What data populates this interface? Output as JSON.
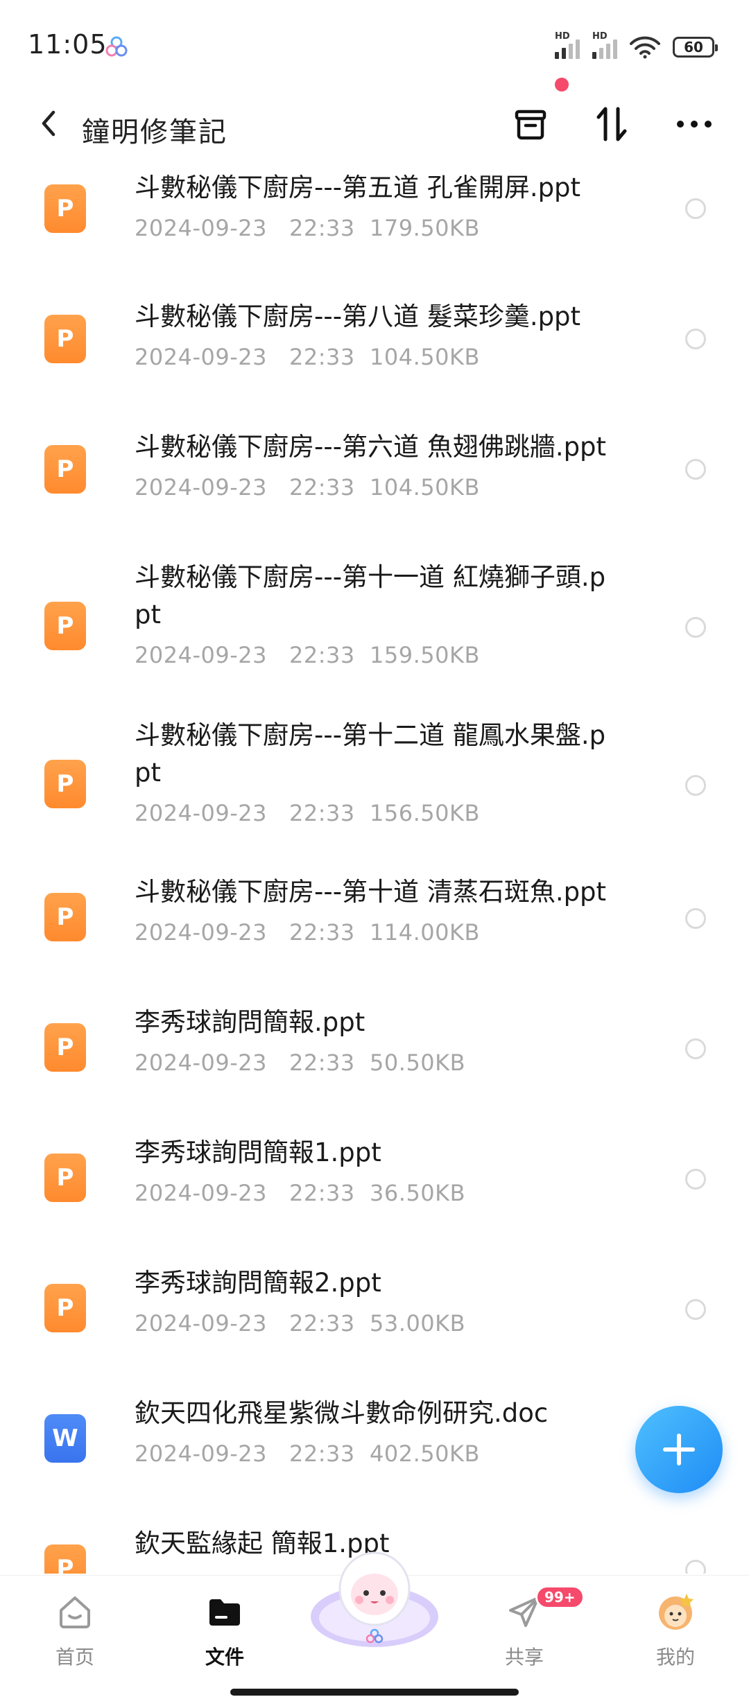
{
  "status_bar": {
    "time": "11:05",
    "signal_1_label": "HD",
    "signal_2_label": "HD",
    "battery": "60"
  },
  "header": {
    "title": "鐘明修筆記"
  },
  "files": [
    {
      "name": "斗數秘儀下廚房---第五道 孔雀開屏.ppt",
      "date": "2024-09-23",
      "time": "22:33",
      "size": "179.50KB",
      "type": "ppt",
      "icon_letter": "P"
    },
    {
      "name": "斗數秘儀下廚房---第八道 髮菜珍羹.ppt",
      "date": "2024-09-23",
      "time": "22:33",
      "size": "104.50KB",
      "type": "ppt",
      "icon_letter": "P"
    },
    {
      "name": "斗數秘儀下廚房---第六道 魚翅佛跳牆.ppt",
      "date": "2024-09-23",
      "time": "22:33",
      "size": "104.50KB",
      "type": "ppt",
      "icon_letter": "P"
    },
    {
      "name": "斗數秘儀下廚房---第十一道 紅燒獅子頭.ppt",
      "date": "2024-09-23",
      "time": "22:33",
      "size": "159.50KB",
      "type": "ppt",
      "icon_letter": "P"
    },
    {
      "name": "斗數秘儀下廚房---第十二道 龍鳳水果盤.ppt",
      "date": "2024-09-23",
      "time": "22:33",
      "size": "156.50KB",
      "type": "ppt",
      "icon_letter": "P"
    },
    {
      "name": "斗數秘儀下廚房---第十道 清蒸石斑魚.ppt",
      "date": "2024-09-23",
      "time": "22:33",
      "size": "114.00KB",
      "type": "ppt",
      "icon_letter": "P"
    },
    {
      "name": "李秀球詢問簡報.ppt",
      "date": "2024-09-23",
      "time": "22:33",
      "size": "50.50KB",
      "type": "ppt",
      "icon_letter": "P"
    },
    {
      "name": "李秀球詢問簡報1.ppt",
      "date": "2024-09-23",
      "time": "22:33",
      "size": "36.50KB",
      "type": "ppt",
      "icon_letter": "P"
    },
    {
      "name": "李秀球詢問簡報2.ppt",
      "date": "2024-09-23",
      "time": "22:33",
      "size": "53.00KB",
      "type": "ppt",
      "icon_letter": "P"
    },
    {
      "name": "欽天四化飛星紫微斗數命例研究.doc",
      "date": "2024-09-23",
      "time": "22:33",
      "size": "402.50KB",
      "type": "doc",
      "icon_letter": "W"
    },
    {
      "name": "欽天監緣起 簡報1.ppt",
      "date": "",
      "time": "",
      "size": "",
      "type": "ppt",
      "icon_letter": "P"
    }
  ],
  "bottom_nav": {
    "home": "首页",
    "files": "文件",
    "share": "共享",
    "share_badge": "99+",
    "mine": "我的"
  },
  "colors": {
    "ppt_icon": "#ff8a2e",
    "doc_icon": "#3a74ee",
    "fab": "#1e8cf5",
    "badge": "#f54a6b"
  },
  "icons": {
    "back": "chevron-left-icon",
    "archive": "archive-icon",
    "sort": "sort-icon",
    "more": "more-icon",
    "fab": "plus-icon",
    "home": "home-icon",
    "files": "folder-icon",
    "share": "paper-plane-icon",
    "mine": "avatar-icon"
  }
}
